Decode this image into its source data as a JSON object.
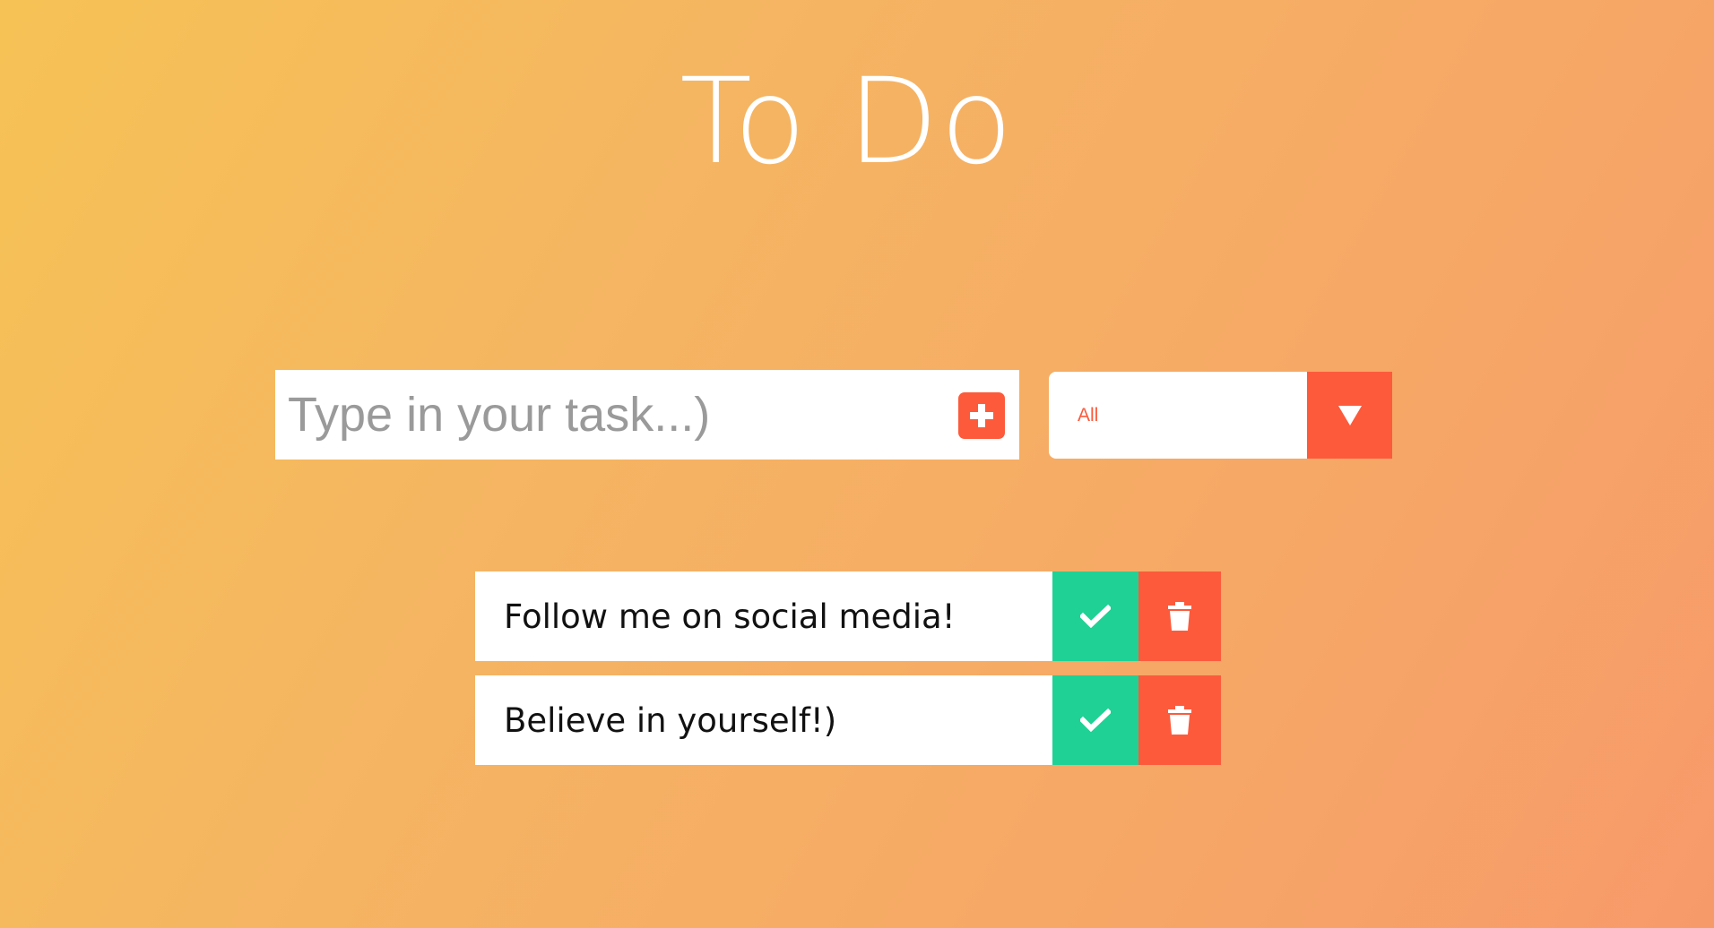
{
  "header": {
    "title": "To Do"
  },
  "task_input": {
    "placeholder": "Type in your task...)",
    "value": "",
    "add_icon": "plus-square-icon"
  },
  "filter": {
    "selected": "All",
    "arrow_icon": "triangle-down-icon"
  },
  "todos": [
    {
      "text": "Follow me on social media!",
      "complete_icon": "check-icon",
      "delete_icon": "trash-icon"
    },
    {
      "text": "Believe in yourself!)",
      "complete_icon": "check-icon",
      "delete_icon": "trash-icon"
    }
  ],
  "colors": {
    "accent": "#fd5a3c",
    "complete": "#1fd195",
    "background_start": "#f6c255",
    "background_end": "#f79a6a"
  }
}
